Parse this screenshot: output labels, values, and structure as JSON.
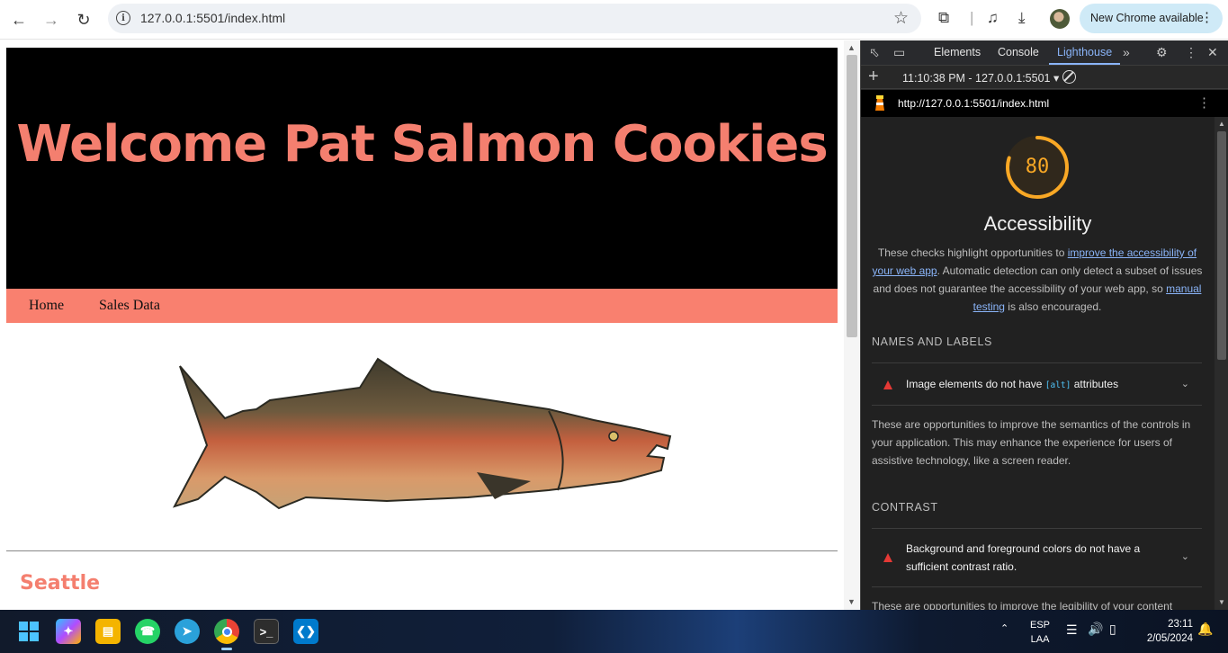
{
  "browser": {
    "url": "127.0.0.1:5501/index.html",
    "update_label": "New Chrome available"
  },
  "page": {
    "hero_title": "Welcome Pat Salmon Cookies",
    "nav": [
      {
        "label": "Home"
      },
      {
        "label": "Sales Data"
      }
    ],
    "city_heading": "Seattle"
  },
  "devtools": {
    "tabs": [
      "Elements",
      "Console",
      "Lighthouse"
    ],
    "active_tab": "Lighthouse",
    "session": "11:10:38 PM - 127.0.0.1:5501",
    "report_url": "http://127.0.0.1:5501/index.html",
    "score": "80",
    "score_color": "#f9a825",
    "score_fraction": 0.8,
    "category": "Accessibility",
    "desc_1": "These checks highlight opportunities to ",
    "desc_link_1": "improve the accessibility of your web app",
    "desc_2": ". Automatic detection can only detect a subset of issues and does not guarantee the accessibility of your web app, so ",
    "desc_link_2": "manual testing",
    "desc_3": " is also encouraged.",
    "groups": [
      {
        "heading": "NAMES AND LABELS",
        "audit_pre": "Image elements do not have ",
        "audit_code": "[alt]",
        "audit_post": " attributes",
        "description": "These are opportunities to improve the semantics of the controls in your application. This may enhance the experience for users of assistive technology, like a screen reader."
      },
      {
        "heading": "CONTRAST",
        "audit": "Background and foreground colors do not have a sufficient contrast ratio.",
        "description": "These are opportunities to improve the legibility of your content"
      }
    ]
  },
  "taskbar": {
    "language": "ESP",
    "layout": "LAA",
    "time": "23:11",
    "date": "2/05/2024"
  }
}
